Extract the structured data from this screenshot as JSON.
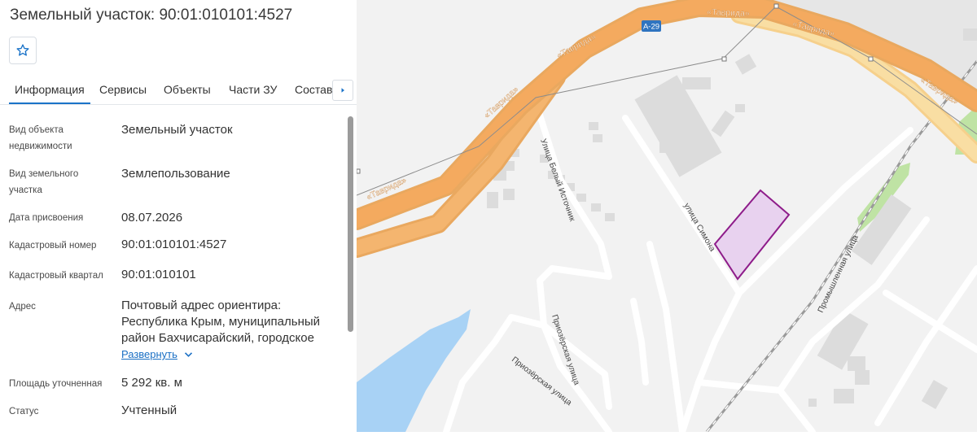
{
  "header": {
    "title": "Земельный участок: 90:01:010101:4527"
  },
  "tabs": [
    "Информация",
    "Сервисы",
    "Объекты",
    "Части ЗУ",
    "Состав"
  ],
  "info": {
    "rows": [
      {
        "label": "Вид объекта недвижимости",
        "value": "Земельный участок"
      },
      {
        "label": "Вид земельного участка",
        "value": "Землепользование"
      },
      {
        "label": "Дата присвоения",
        "value": "08.07.2026"
      },
      {
        "label": "Кадастровый номер",
        "value": "90:01:010101:4527"
      },
      {
        "label": "Кадастровый квартал",
        "value": "90:01:010101"
      },
      {
        "label": "Адрес",
        "value": "Почтовый адрес ориентира: Республика Крым, муниципальный район Бахчисарайский, городское"
      },
      {
        "label": "Площадь уточненная",
        "value": "5 292 кв. м"
      },
      {
        "label": "Статус",
        "value": "Учтенный"
      }
    ],
    "expand_label": "Развернуть"
  },
  "map": {
    "highway_label": "«Таврида»",
    "route_badge": "А-29",
    "streets": {
      "beliy_istochnik": "Улица Белый Источник",
      "simona": "улица Симона",
      "priozernaya_1": "Приозёрская улица",
      "priozernaya_2": "Приозёрская улица",
      "promyshlennaya": "Промышленная улица"
    },
    "colors": {
      "highway": "#f4aa5f",
      "parcel_fill": "#e6cdee",
      "parcel_stroke": "#8e1c8a",
      "water": "#a8d2f5",
      "green": "#bfe3a4"
    }
  },
  "icons": {
    "favorite": "star-outline-icon",
    "tabs_next": "chevron-right-icon",
    "expand": "chevron-down-icon"
  }
}
